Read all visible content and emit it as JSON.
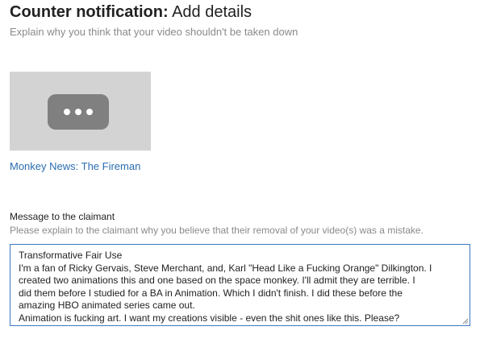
{
  "header": {
    "title_bold": "Counter notification:",
    "title_rest": " Add details",
    "subtitle": "Explain why you think that your video shouldn't be taken down"
  },
  "video": {
    "thumbnail_icon": "more-dots-icon",
    "title": "Monkey News: The Fireman"
  },
  "message": {
    "label": "Message to the claimant",
    "hint": "Please explain to the claimant why you believe that their removal of your video(s) was a mistake.",
    "lines": [
      "Transformative Fair Use",
      "I'm a fan of Ricky Gervais, Steve Merchant, and, Karl \"Head Like a Fucking Orange\" Dilkington. I",
      "created two animations this and one based on the space monkey. I'll admit they are terrible. I",
      "did them before I studied for a BA in Animation. Which I didn't finish. I did these before the",
      "amazing HBO animated series came out.",
      "Animation is fucking art. I want my creations visible - even the shit ones like this. Please?"
    ]
  },
  "colors": {
    "link": "#2a6db0",
    "focus_border": "#3b78c4",
    "hint_text": "#8a8a8a"
  }
}
